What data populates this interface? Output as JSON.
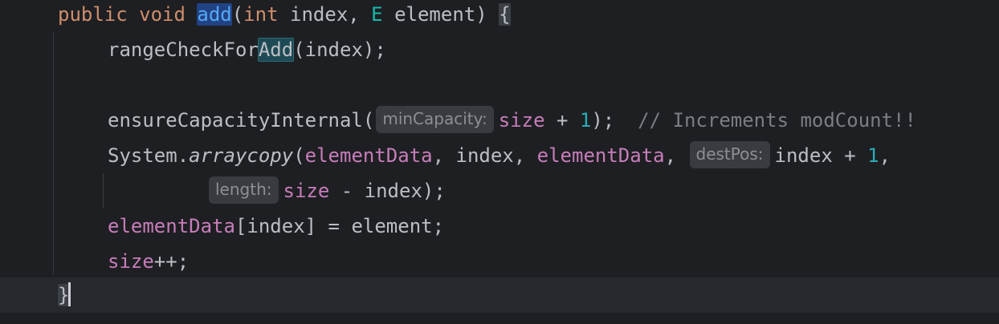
{
  "editor": {
    "lines": {
      "l1": {
        "kw_public": "public",
        "kw_void": "void",
        "method_name": "add",
        "paren_open": "(",
        "kw_int": "int",
        "param_index": " index, ",
        "type_e": "E",
        "param_element": " element) ",
        "brace_open": "{"
      },
      "l2": {
        "call_prefix": "rangeCheckFor",
        "call_highlight": "Add",
        "call_args": "(index);"
      },
      "l4": {
        "call": "ensureCapacityInternal(",
        "hint": "minCapacity:",
        "field_size": "size",
        "op": " + ",
        "num": "1",
        "close": ");",
        "comment": "// Increments modCount!!"
      },
      "l5": {
        "cls": "System.",
        "method": "arraycopy",
        "paren": "(",
        "field1": "elementData",
        "mid": ", index, ",
        "field2": "elementData",
        "comma": ",",
        "hint": "destPos:",
        "tail": "index + ",
        "num": "1",
        "end": ","
      },
      "l6": {
        "hint": "length:",
        "field": "size",
        "rest": " - index);"
      },
      "l7": {
        "field": "elementData",
        "rest": "[index] = element;"
      },
      "l8": {
        "field": "size",
        "rest": "++;"
      },
      "l9": {
        "brace_close": "}"
      }
    }
  }
}
